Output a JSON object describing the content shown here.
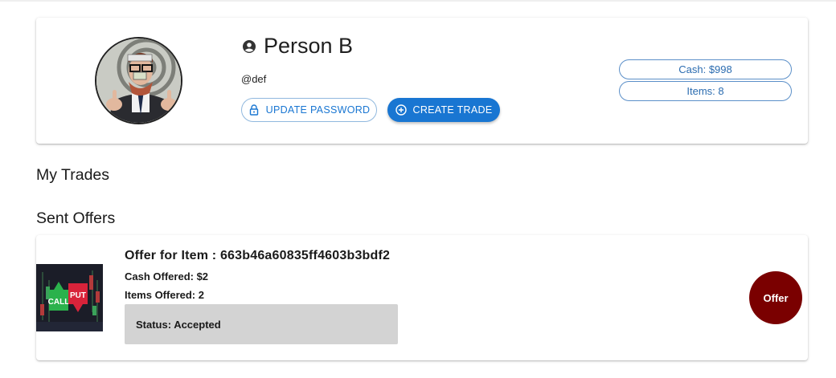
{
  "profile": {
    "name": "Person B",
    "handle": "@def",
    "update_password_label": "UPDATE PASSWORD",
    "create_trade_label": "CREATE TRADE",
    "cash_label": "Cash: $998",
    "items_label": "Items: 8"
  },
  "sections": {
    "my_trades": "My Trades",
    "sent_offers": "Sent Offers"
  },
  "offers": [
    {
      "title": "Offer for Item : 663b46a60835ff4603b3bdf2",
      "cash_offered": "Cash Offered: $2",
      "items_offered": "Items Offered: 2",
      "status": "Status: Accepted",
      "badge": "Offer",
      "thumb_text_top": "CALL",
      "thumb_text_right": "PUT"
    }
  ],
  "colors": {
    "primary": "#1976d2",
    "pill_border": "#5b8fc8",
    "offer_badge": "#7a0000",
    "status_bg": "#d3d3d3"
  },
  "icons": [
    "account-circle-icon",
    "lock-icon",
    "add-circle-icon"
  ]
}
